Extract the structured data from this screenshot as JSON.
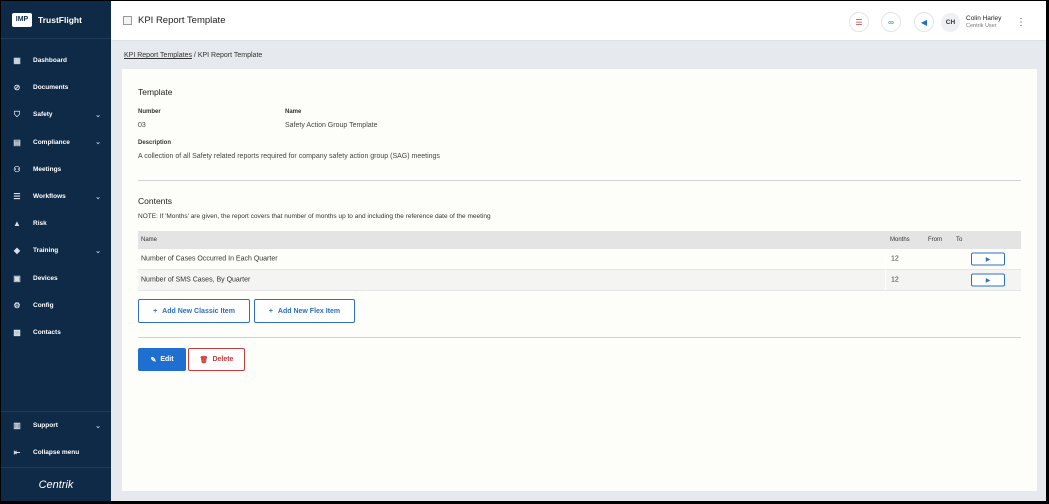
{
  "brand": {
    "logo": "IMP",
    "name": "TrustFlight"
  },
  "sidebar": {
    "items": [
      {
        "label": "Dashboard",
        "icon": "dashboard-icon",
        "chevron": false
      },
      {
        "label": "Documents",
        "icon": "paperclip-icon",
        "chevron": false
      },
      {
        "label": "Safety",
        "icon": "shield-icon",
        "chevron": true
      },
      {
        "label": "Compliance",
        "icon": "clipboard-icon",
        "chevron": true
      },
      {
        "label": "Meetings",
        "icon": "people-icon",
        "chevron": false
      },
      {
        "label": "Workflows",
        "icon": "workflow-icon",
        "chevron": true
      },
      {
        "label": "Risk",
        "icon": "warning-icon",
        "chevron": false
      },
      {
        "label": "Training",
        "icon": "graduation-cap-icon",
        "chevron": true
      },
      {
        "label": "Devices",
        "icon": "devices-icon",
        "chevron": false
      },
      {
        "label": "Config",
        "icon": "gears-icon",
        "chevron": false
      },
      {
        "label": "Contacts",
        "icon": "contacts-icon",
        "chevron": false
      }
    ],
    "support": "Support",
    "collapse": "Collapse menu",
    "footer_logo": "Centrik"
  },
  "header": {
    "title": "KPI Report Template",
    "user": {
      "initials": "CH",
      "name": "Colin Harley",
      "role": "Centrik User"
    }
  },
  "breadcrumb": {
    "parent": "KPI Report Templates",
    "separator": "/",
    "current": "KPI Report Template"
  },
  "template": {
    "section_title": "Template",
    "number_label": "Number",
    "number_value": "03",
    "name_label": "Name",
    "name_value": "Safety Action Group Template",
    "description_label": "Description",
    "description_value": "A collection of all Safety related reports required for company safety action group (SAG) meetings"
  },
  "contents": {
    "section_title": "Contents",
    "note": "NOTE: If 'Months' are given, the report covers that number of months up to and including the reference date of the meeting",
    "columns": {
      "name": "Name",
      "months": "Months",
      "from": "From",
      "to": "To"
    },
    "rows": [
      {
        "name": "Number of Cases Occurred In Each Quarter",
        "months": "12",
        "from": "",
        "to": ""
      },
      {
        "name": "Number of SMS Cases, By Quarter",
        "months": "12",
        "from": "",
        "to": ""
      }
    ],
    "add_classic": "Add New Classic Item",
    "add_flex": "Add New Flex Item"
  },
  "actions": {
    "edit": "Edit",
    "delete": "Delete"
  },
  "colors": {
    "sidebar": "#0f2a47",
    "primary": "#1f6fd1",
    "danger": "#c93a3a"
  }
}
